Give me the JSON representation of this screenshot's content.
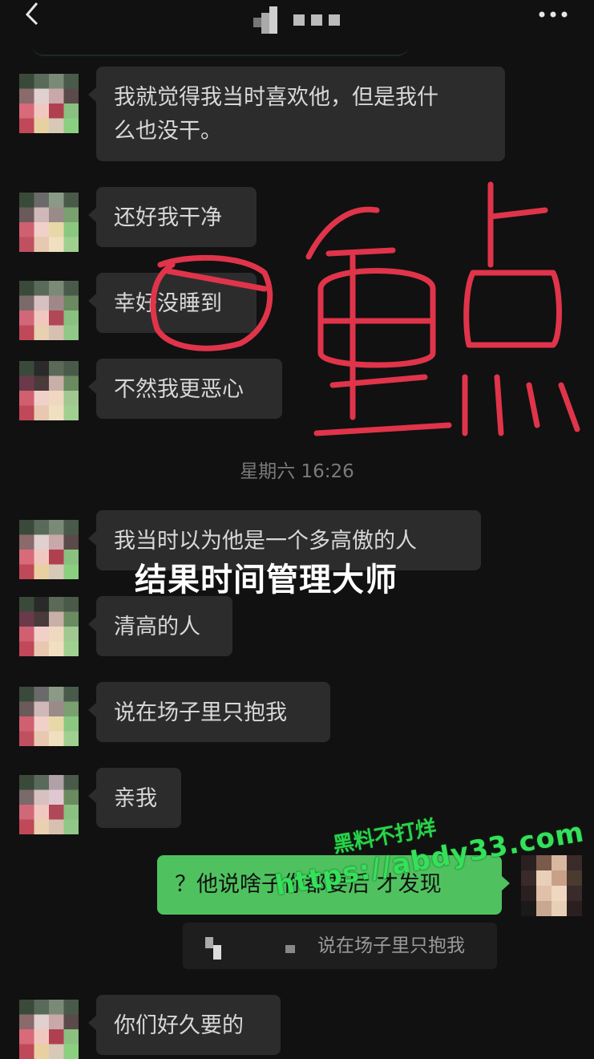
{
  "header": {
    "back_icon": "chevron-left-icon",
    "more_icon": "ellipsis-icon",
    "title": ""
  },
  "messages": [
    {
      "text": "我就觉得我当时喜欢他，但是我什\n么也没干。"
    },
    {
      "text": "还好我干净"
    },
    {
      "text": "幸好没睡到"
    },
    {
      "text": "不然我更恶心"
    },
    {
      "text": "我当时以为他是一个多高傲的人"
    },
    {
      "text": "清高的人"
    },
    {
      "text": "说在场子里只抱我"
    },
    {
      "text": "亲我"
    },
    {
      "text": "你们好久要的"
    }
  ],
  "timestamp": "星期六 16:26",
  "caption": "结果时间管理大师",
  "annotation": {
    "text": "重点",
    "color": "#e0344a"
  },
  "my_message": {
    "text": "？他说啥子你都要后 才发现"
  },
  "quote": {
    "text": "说在场子里只抱我"
  },
  "watermark": {
    "line1": "黑料不打烊",
    "line2": "https://abdy33.com",
    "color": "#35e05a"
  },
  "colors": {
    "background": "#111111",
    "bubble": "#2c2c2c",
    "my_bubble": "#4fc25f"
  }
}
